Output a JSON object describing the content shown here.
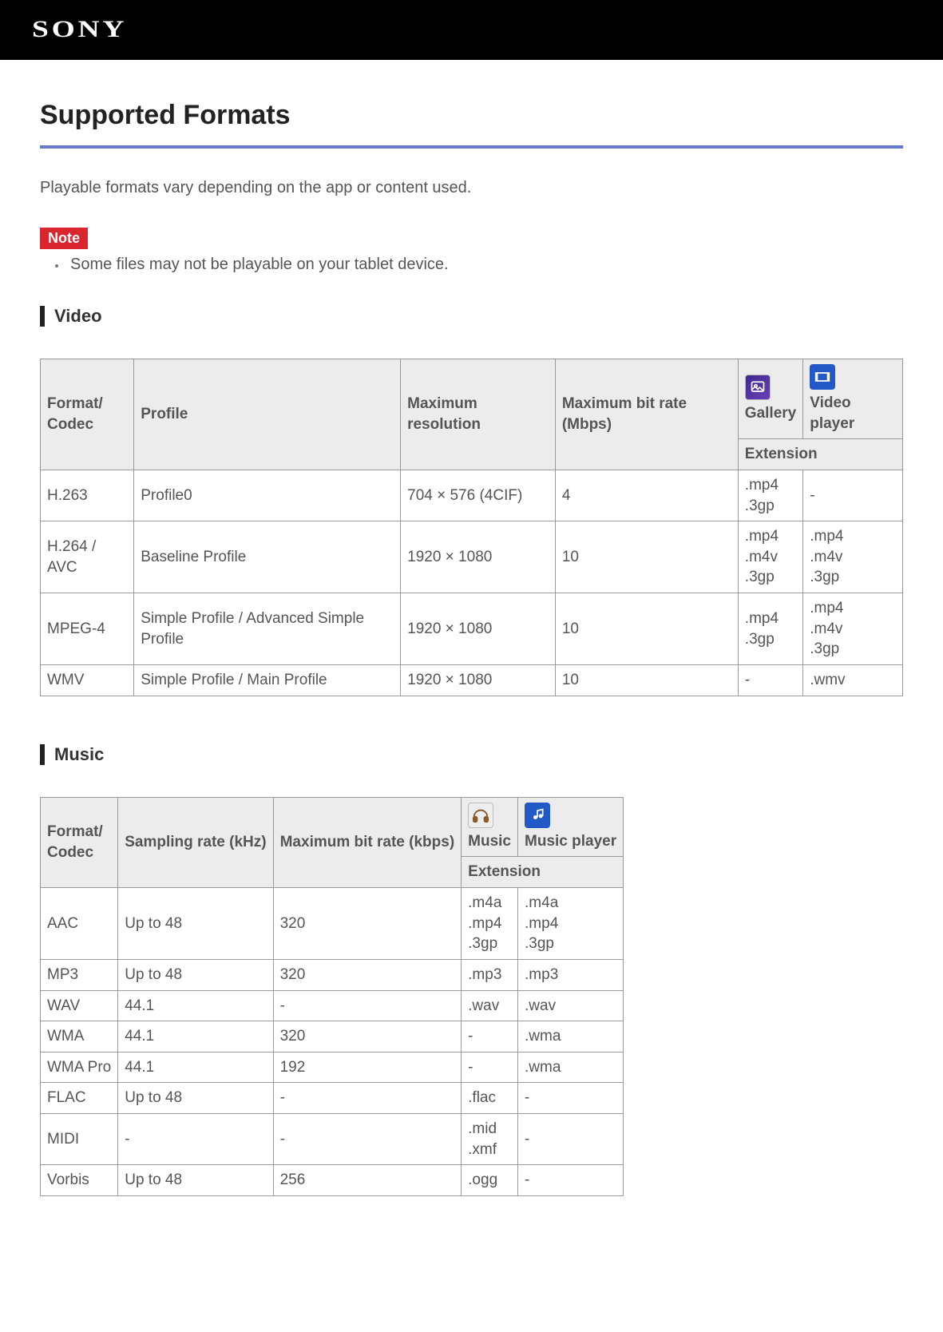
{
  "brand": "SONY",
  "page_title": "Supported Formats",
  "intro": "Playable formats vary depending on the app or content used.",
  "note_label": "Note",
  "notes": [
    "Some files may not be playable on your tablet device."
  ],
  "video": {
    "heading": "Video",
    "headers": {
      "format": "Format/\nCodec",
      "profile": "Profile",
      "max_res": "Maximum resolution",
      "max_bitrate": "Maximum bit rate (Mbps)",
      "gallery": "Gallery",
      "video_player": "Video player",
      "extension": "Extension"
    },
    "rows": [
      {
        "format": "H.263",
        "profile": "Profile0",
        "max_res": "704 × 576 (4CIF)",
        "max_bitrate": "4",
        "gallery": ".mp4\n.3gp",
        "player": "-"
      },
      {
        "format": "H.264 / AVC",
        "profile": "Baseline Profile",
        "max_res": "1920 × 1080",
        "max_bitrate": "10",
        "gallery": ".mp4\n.m4v\n.3gp",
        "player": ".mp4\n.m4v\n.3gp"
      },
      {
        "format": "MPEG-4",
        "profile": "Simple Profile / Advanced Simple Profile",
        "max_res": "1920 × 1080",
        "max_bitrate": "10",
        "gallery": ".mp4\n.3gp",
        "player": ".mp4\n.m4v\n.3gp"
      },
      {
        "format": "WMV",
        "profile": "Simple Profile / Main Profile",
        "max_res": "1920 × 1080",
        "max_bitrate": "10",
        "gallery": "-",
        "player": ".wmv"
      }
    ]
  },
  "music": {
    "heading": "Music",
    "headers": {
      "format": "Format/\nCodec",
      "sampling": "Sampling rate (kHz)",
      "max_bitrate": "Maximum bit rate (kbps)",
      "music": "Music",
      "music_player": "Music player",
      "extension": "Extension"
    },
    "rows": [
      {
        "format": "AAC",
        "sampling": "Up to 48",
        "max_bitrate": "320",
        "music": ".m4a\n.mp4\n.3gp",
        "player": ".m4a\n.mp4\n.3gp"
      },
      {
        "format": "MP3",
        "sampling": "Up to 48",
        "max_bitrate": "320",
        "music": ".mp3",
        "player": ".mp3"
      },
      {
        "format": "WAV",
        "sampling": "44.1",
        "max_bitrate": "-",
        "music": ".wav",
        "player": ".wav"
      },
      {
        "format": "WMA",
        "sampling": "44.1",
        "max_bitrate": "320",
        "music": "-",
        "player": ".wma"
      },
      {
        "format": "WMA Pro",
        "sampling": "44.1",
        "max_bitrate": "192",
        "music": "-",
        "player": ".wma"
      },
      {
        "format": "FLAC",
        "sampling": "Up to 48",
        "max_bitrate": "-",
        "music": ".flac",
        "player": "-"
      },
      {
        "format": "MIDI",
        "sampling": "-",
        "max_bitrate": "-",
        "music": ".mid\n.xmf",
        "player": "-"
      },
      {
        "format": "Vorbis",
        "sampling": "Up to 48",
        "max_bitrate": "256",
        "music": ".ogg",
        "player": "-"
      }
    ]
  }
}
